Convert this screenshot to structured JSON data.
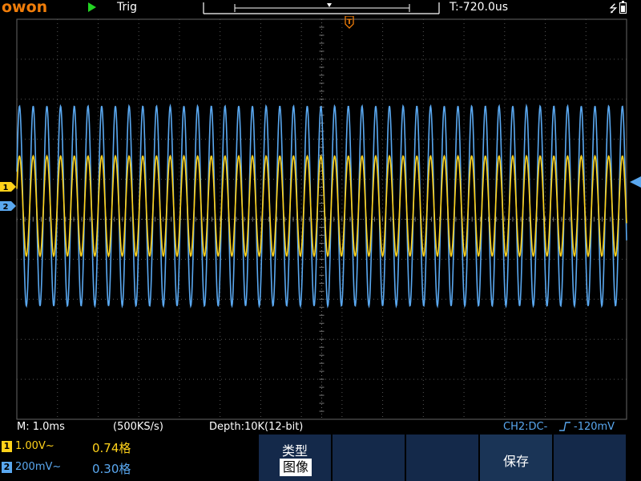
{
  "brand": "owon",
  "header": {
    "run_state": "play-icon",
    "trigger_status": "Trig",
    "trigger_time": "T:-720.0us",
    "usb_icon": "usb-icon",
    "battery_icon": "battery-icon",
    "trigger_marker": "T"
  },
  "colors": {
    "ch1": "#ffd21a",
    "ch2": "#5aa8f0",
    "brand": "#f07d0a",
    "menu": "#14294a"
  },
  "channel_markers": {
    "ch1": "1",
    "ch2": "2"
  },
  "status_bar": {
    "timebase": "M: 1.0ms",
    "sample_rate": "(500KS/s)",
    "depth": "Depth:10K(12-bit)",
    "trigger_info": "CH2:DC-",
    "trigger_level": "-120mV"
  },
  "channels": [
    {
      "badge": "1",
      "scale": "1.00V~",
      "value": "0.74格"
    },
    {
      "badge": "2",
      "scale": "200mV~",
      "value": "0.30格"
    }
  ],
  "menu": {
    "type_label": "类型",
    "type_value": "图像",
    "save_label": "保存"
  },
  "waveforms": {
    "cycles_on_screen": 44.5,
    "ch1_peak_to_peak_div": 2.5,
    "ch2_peak_to_peak_div": 5.0
  }
}
